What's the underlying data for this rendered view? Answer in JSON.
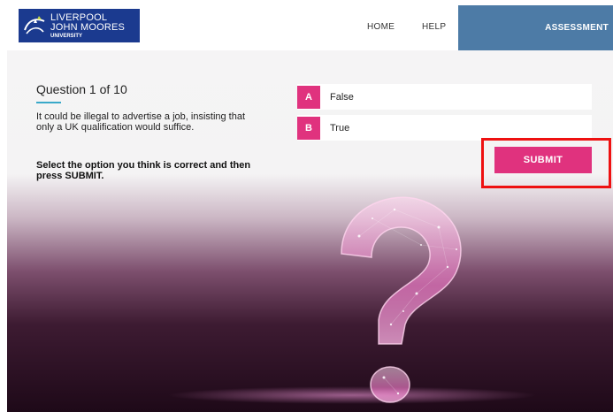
{
  "header": {
    "logo": {
      "line1": "LIVERPOOL",
      "line2": "JOHN MOORES",
      "line3": "UNIVERSITY"
    },
    "nav": {
      "home": "HOME",
      "help": "HELP",
      "assessment": "ASSESSMENT"
    },
    "colors": {
      "brand": "#1b3a8f",
      "active_tab": "#4d7ba6"
    }
  },
  "question": {
    "title": "Question 1 of 10",
    "text": "It could be illegal to advertise a job, insisting that only a UK qualification would suffice.",
    "instruction": "Select the option you think is correct and then press SUBMIT."
  },
  "options": [
    {
      "letter": "A",
      "label": "False"
    },
    {
      "letter": "B",
      "label": "True"
    }
  ],
  "submit_label": "SUBMIT",
  "colors": {
    "accent": "#e0327e",
    "underline": "#39a9c9",
    "highlight_box": "#ee1111"
  },
  "icons": {
    "logo_mark": "liver-bird-icon",
    "background_art": "question-mark-icon"
  }
}
